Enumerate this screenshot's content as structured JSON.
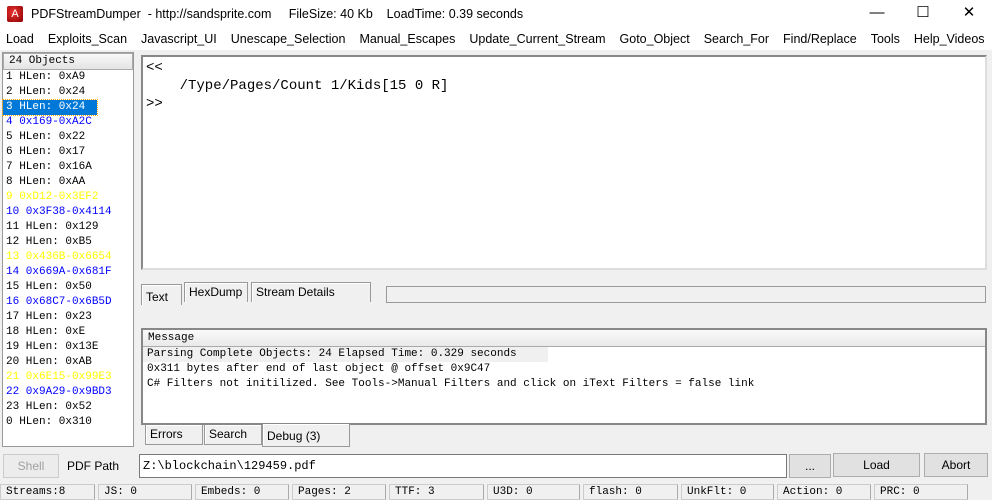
{
  "window": {
    "title": "PDFStreamDumper  - http://sandsprite.com     FileSize: 40 Kb    LoadTime: 0.39 seconds",
    "minimize": "—",
    "maximize": "☐",
    "close": "✕"
  },
  "menu": [
    "Load",
    "Exploits_Scan",
    "Javascript_UI",
    "Unescape_Selection",
    "Manual_Escapes",
    "Update_Current_Stream",
    "Goto_Object",
    "Search_For",
    "Find/Replace",
    "Tools",
    "Help_Videos"
  ],
  "colors": {
    "normal": "#000000",
    "selected_bg": "#0078d7",
    "stream": "#0000ff",
    "js_or_flagged": "#ffff00"
  },
  "objects": {
    "header": "24 Objects",
    "selected_index": 2,
    "items": [
      {
        "label": "1 HLen: 0xA9",
        "kind": "normal"
      },
      {
        "label": "2 HLen: 0x24",
        "kind": "normal"
      },
      {
        "label": "3 HLen: 0x24",
        "kind": "normal"
      },
      {
        "label": "4 0x169-0xA2C",
        "kind": "stream"
      },
      {
        "label": "5 HLen: 0x22",
        "kind": "normal"
      },
      {
        "label": "6 HLen: 0x17",
        "kind": "normal"
      },
      {
        "label": "7 HLen: 0x16A",
        "kind": "normal"
      },
      {
        "label": "8 HLen: 0xAA",
        "kind": "normal"
      },
      {
        "label": "9 0xD12-0x3EF2",
        "kind": "flagged"
      },
      {
        "label": "10 0x3F38-0x4114",
        "kind": "stream"
      },
      {
        "label": "11 HLen: 0x129",
        "kind": "normal"
      },
      {
        "label": "12 HLen: 0xB5",
        "kind": "normal"
      },
      {
        "label": "13 0x436B-0x6654",
        "kind": "flagged"
      },
      {
        "label": "14 0x669A-0x681F",
        "kind": "stream"
      },
      {
        "label": "15 HLen: 0x50",
        "kind": "normal"
      },
      {
        "label": "16 0x68C7-0x6B5D",
        "kind": "stream"
      },
      {
        "label": "17 HLen: 0x23",
        "kind": "normal"
      },
      {
        "label": "18 HLen: 0xE",
        "kind": "normal"
      },
      {
        "label": "19 HLen: 0x13E",
        "kind": "normal"
      },
      {
        "label": "20 HLen: 0xAB",
        "kind": "normal"
      },
      {
        "label": "21 0x6E15-0x99E3",
        "kind": "flagged"
      },
      {
        "label": "22 0x9A29-0x9BD3",
        "kind": "stream"
      },
      {
        "label": "23 HLen: 0x52",
        "kind": "normal"
      },
      {
        "label": "0 HLen: 0x310",
        "kind": "normal"
      }
    ]
  },
  "editor": {
    "content": "<<\n    /Type/Pages/Count 1/Kids[15 0 R]\n>>"
  },
  "tabs": {
    "top": [
      "Text",
      "HexDump",
      "Stream Details"
    ],
    "active_top": "Text",
    "bottom": [
      "Errors",
      "Search",
      "Debug (3)"
    ],
    "active_bottom": "Debug (3)"
  },
  "messages": {
    "header": "Message",
    "lines": [
      "Parsing Complete Objects: 24  Elapsed Time: 0.329 seconds",
      "0x311 bytes after end of last object @ offset 0x9C47",
      "C# Filters not initilized. See Tools->Manual Filters and click on iText Filters = false link"
    ]
  },
  "pathbar": {
    "shell": "Shell",
    "label": "PDF Path",
    "path": "Z:\\blockchain\\129459.pdf",
    "browse": "...",
    "load": "Load",
    "abort": "Abort"
  },
  "status": [
    "Streams:8",
    "JS: 0",
    "Embeds: 0",
    "Pages: 2",
    "TTF: 3",
    "U3D: 0",
    "flash: 0",
    "UnkFlt: 0",
    "Action: 0",
    "PRC: 0"
  ]
}
